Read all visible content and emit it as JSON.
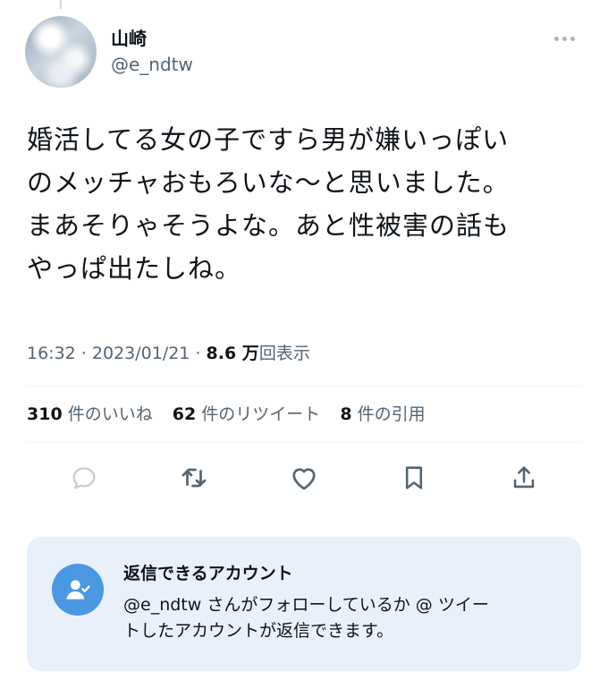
{
  "author": {
    "display_name": "山崎",
    "handle": "@e_ndtw"
  },
  "tweet": {
    "lines": [
      "婚活してる女の子ですら男が嫌いっぽい",
      "のメッチャおもろいな〜と思いました。",
      "まあそりゃそうよな。あと性被害の話も",
      "やっぱ出たしね。"
    ]
  },
  "meta": {
    "time": "16:32",
    "separator": " · ",
    "date": "2023/01/21",
    "separator2": " · ",
    "views_value": "8.6 万",
    "views_label": "回表示"
  },
  "stats": {
    "likes_count": "310",
    "likes_label": "件のいいね",
    "retweets_count": "62",
    "retweets_label": "件のリツイート",
    "quotes_count": "8",
    "quotes_label": "件の引用"
  },
  "reply_notice": {
    "title": "返信できるアカウント",
    "body_lines": [
      "@e_ndtw さんがフォローしているか @ ツイー",
      "トしたアカウントが返信できます。"
    ]
  },
  "icons": {
    "reply": "reply-icon",
    "retweet": "retweet-icon",
    "like": "heart-icon",
    "bookmark": "bookmark-icon",
    "share": "share-icon",
    "more": "more-dots-icon",
    "notice": "person-check-icon"
  },
  "colors": {
    "text": "#0f1419",
    "secondary": "#536471",
    "notice_bg": "#e8f1fb",
    "notice_icon": "#4a98e2"
  }
}
